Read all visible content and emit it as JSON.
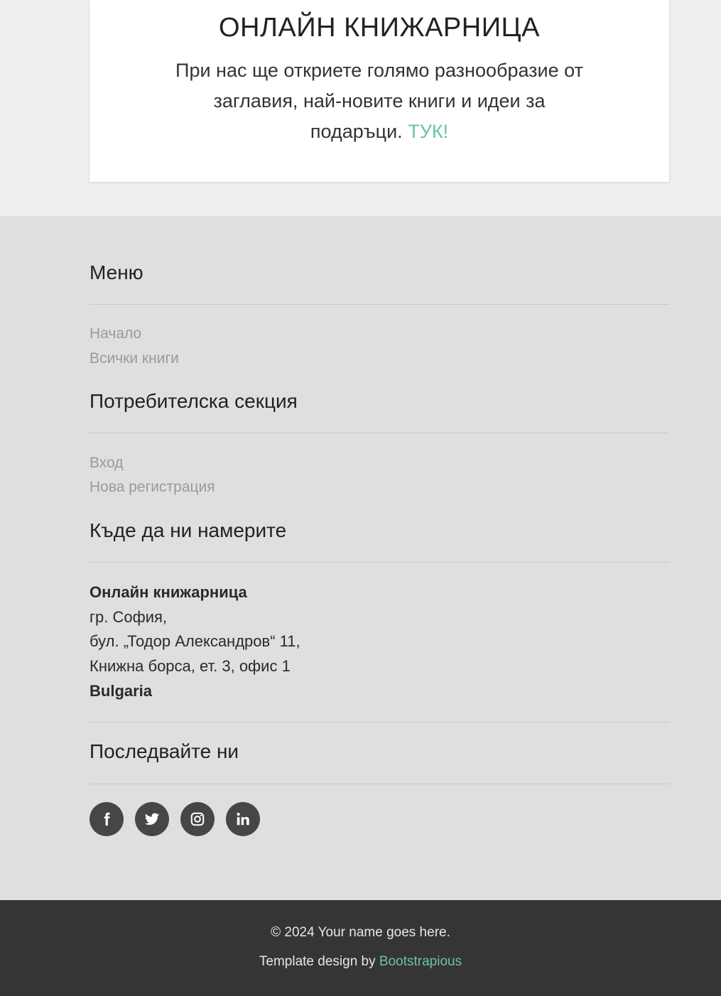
{
  "promo": {
    "title": "ОНЛАЙН КНИЖАРНИЦА",
    "line1": "При нас ще откриете голямо разнообразие от",
    "line2": "заглавия, най-новите книги и идеи за",
    "line3": "подаръци.",
    "link_label": "ТУК!"
  },
  "footer": {
    "menu": {
      "heading": "Меню",
      "links": [
        "Начало",
        "Всички книги"
      ]
    },
    "user_section": {
      "heading": "Потребителска секция",
      "links": [
        "Вход",
        "Нова регистрация"
      ]
    },
    "location": {
      "heading": "Къде да ни намерите",
      "name": "Онлайн книжарница",
      "city": "гр. София,",
      "street": "бул. „Тодор Александров“ 11,",
      "building": "Книжна борса, ет. 3, офис 1",
      "country": "Bulgaria"
    },
    "follow": {
      "heading": "Последвайте ни",
      "icons": [
        "facebook-icon",
        "twitter-icon",
        "instagram-icon",
        "linkedin-icon"
      ]
    }
  },
  "bottom_bar": {
    "copyright": "© 2024 Your name goes here.",
    "credit_prefix": "Template design by",
    "credit_link": "Bootstrapious"
  },
  "colors": {
    "accent": "#6cc3a0",
    "footer_bg": "#dfdfdf",
    "bottom_bar_bg": "#353535",
    "social_bg": "#464646"
  }
}
